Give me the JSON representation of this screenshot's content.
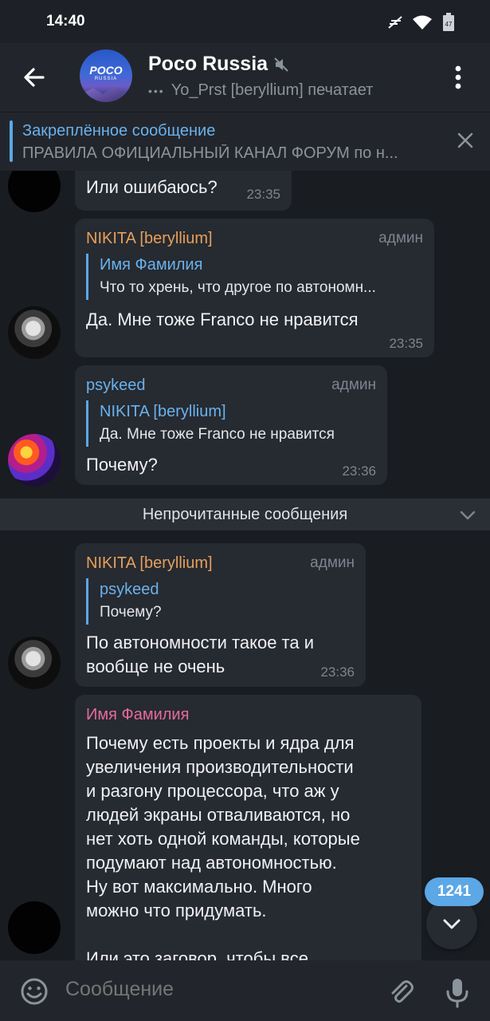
{
  "status_bar": {
    "time": "14:40",
    "battery": "47"
  },
  "header": {
    "title": "Poco Russia",
    "avatar_logo": "POCO",
    "avatar_logo_sub": "RUSSIA",
    "typing_status": "Yo_Prst [beryllium] печатает",
    "icons": {
      "back": "arrow-left-icon",
      "muted": "muted-speaker-icon",
      "menu": "more-vertical-icon"
    }
  },
  "pinned": {
    "title": "Закреплённое сообщение",
    "text": "ПРАВИЛА ОФИЦИАЛЬНЫЙ КАНАЛ ФОРУМ по н..."
  },
  "messages": [
    {
      "text": "Или ошибаюсь?",
      "time": "23:35"
    },
    {
      "sender": "NIKITA [beryllium]",
      "role": "админ",
      "reply": {
        "name": "Имя Фамилия",
        "text": "Что то хрень, что другое по автономн..."
      },
      "text": "Да. Мне тоже Franco не нравится",
      "time": "23:35"
    },
    {
      "sender": "psykeed",
      "role": "админ",
      "reply": {
        "name": "NIKITA [beryllium]",
        "text": "Да. Мне тоже Franco не нравится"
      },
      "text": "Почему?",
      "time": "23:36"
    },
    {
      "sender": "NIKITA [beryllium]",
      "role": "админ",
      "reply": {
        "name": "psykeed",
        "text": "Почему?"
      },
      "text_lines": [
        "По автономности такое та и",
        "вообще не очень"
      ],
      "time": "23:36"
    },
    {
      "sender": "Имя Фамилия",
      "text_lines": [
        "Почему есть проекты и ядра для",
        "увеличения производительности",
        "и разгону процессора, что аж у",
        "людей экраны отваливаются, но",
        "нет хоть одной команды, которые",
        "подумают  над автономностью.",
        "Ну вот максимально. Много",
        "можно что придумать.",
        "",
        "Или это заговор, чтобы все"
      ]
    }
  ],
  "unread_divider": "Непрочитанные сообщения",
  "unread_count": "1241",
  "composer": {
    "placeholder": "Сообщение"
  },
  "colors": {
    "accent": "#5ca7e6",
    "sender_orange": "#e6a05a",
    "sender_blue": "#6ab2ec",
    "sender_pink": "#e76a9f",
    "bubble": "#262a31",
    "background": "#191c21"
  }
}
